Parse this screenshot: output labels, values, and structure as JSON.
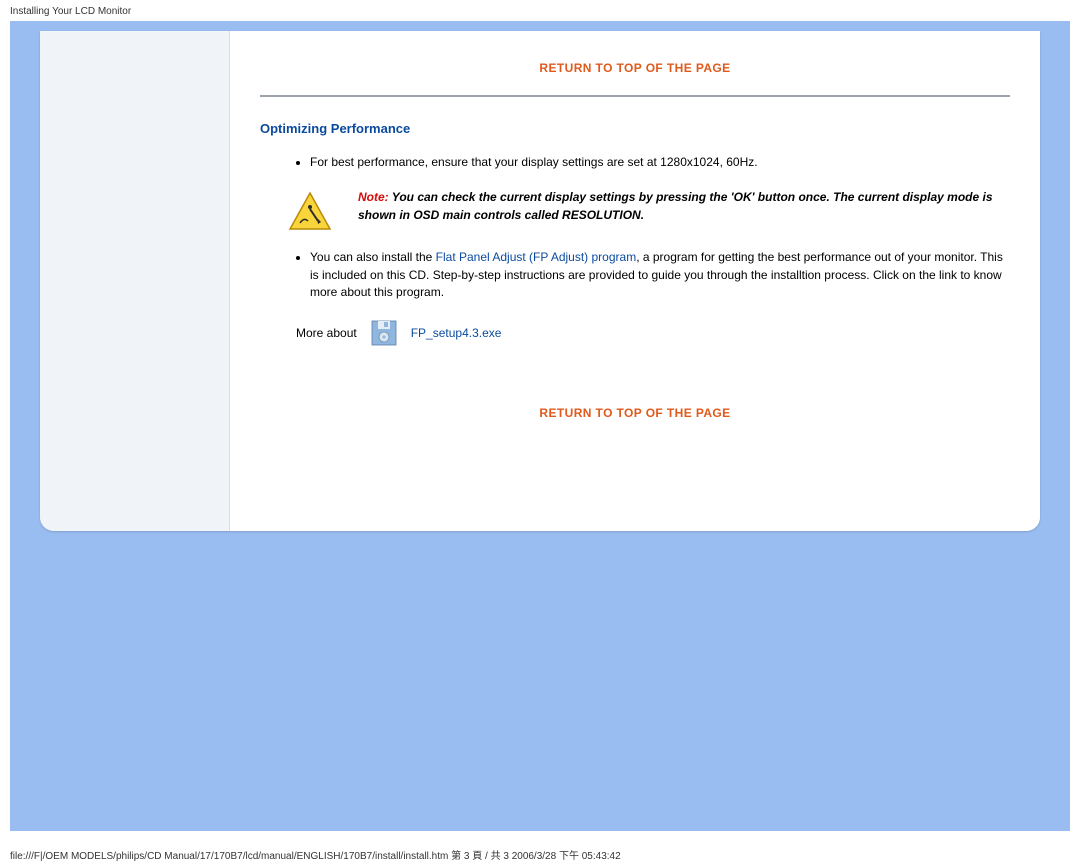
{
  "header": {
    "title": "Installing Your LCD Monitor"
  },
  "content": {
    "return_top": "RETURN TO TOP OF THE PAGE",
    "section_title": "Optimizing Performance",
    "bullet1": "For best performance, ensure that your display settings are set at 1280x1024, 60Hz.",
    "note_label": "Note: ",
    "note_body": "You can check the current display settings by pressing the 'OK' button once. The current display mode is shown in OSD main controls called RESOLUTION.",
    "bullet2_pre": "You can also install the ",
    "bullet2_link": "Flat Panel Adjust (FP Adjust) program",
    "bullet2_post": ", a program for getting the best performance out of your monitor. This is included on this CD. Step-by-step instructions are provided to guide you through the installtion process. Click on the link to know more about this program.",
    "more_about": "More about",
    "file_name": "FP_setup4.3.exe",
    "return_bottom": "RETURN TO TOP OF THE PAGE"
  },
  "footer": {
    "text": "file:///F|/OEM MODELS/philips/CD Manual/17/170B7/lcd/manual/ENGLISH/170B7/install/install.htm 第 3 頁 / 共 3 2006/3/28 下午 05:43:42"
  }
}
